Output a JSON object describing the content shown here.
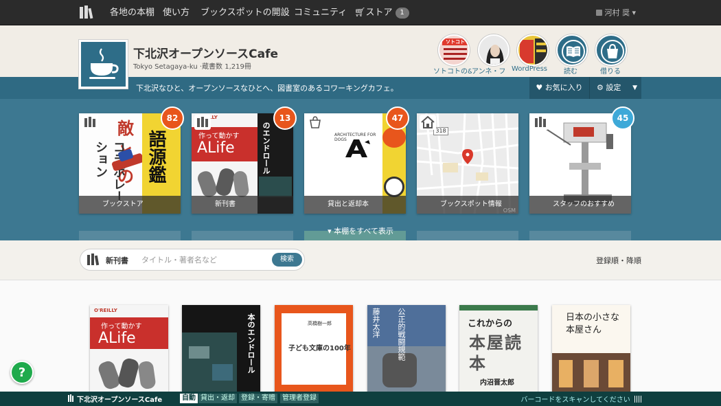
{
  "nav": {
    "items": [
      "各地の本棚",
      "使い方",
      "ブックスポットの開設",
      "コミュニティ"
    ],
    "store_label": "ストア",
    "store_count": "1",
    "user": "河村 奨"
  },
  "library": {
    "title": "下北沢オープンソースCafe",
    "subtitle": "Tokyo Setagaya-ku ·蔵書数 1,219冊",
    "tagline": "下北沢なひと、オープンソースなひとへ、図書室のあるコワーキングカフェ。",
    "fav_label": "お気に入り",
    "settings_label": "設定"
  },
  "chips": [
    {
      "label": "ソトコトの&",
      "cover": "ソトコト"
    },
    {
      "label": "アンネ・フ",
      "cover": ""
    },
    {
      "label": "WordPress",
      "cover": ""
    },
    {
      "label": "読む",
      "cover": ""
    },
    {
      "label": "借りる",
      "cover": ""
    }
  ],
  "shelves": [
    {
      "caption": "ブックストア",
      "count": "82",
      "color": "#e8561c"
    },
    {
      "caption": "新刊書",
      "count": "13",
      "color": "#e8561c"
    },
    {
      "caption": "貸出と返却本",
      "count": "47",
      "color": "#e8561c"
    },
    {
      "caption": "ブックスポット情報",
      "count": "",
      "color": "#e8561c"
    },
    {
      "caption": "スタッフのおすすめ",
      "count": "45",
      "color": "#3ea9d8"
    }
  ],
  "shelf_texts": {
    "c1_big": "敵との",
    "c1_big2": "コラボレーション",
    "c1_side": "語源鑑",
    "c2_brand": "O'REILLY",
    "c2_title": "作って動かす",
    "c2_big": "ALife",
    "c2_side": "のエンドロール",
    "c3_brand": "ARCHITECTURE FOR DOGS",
    "c4_road": "318",
    "c4_osm": "OSM"
  },
  "show_all": "▾ 本棚をすべて表示",
  "search": {
    "label": "新刊書",
    "placeholder": "タイトル・著者名など",
    "button": "検索",
    "sort": "登録順・降順"
  },
  "books": [
    {
      "texts": [
        "O'REILLY",
        "作って動かす",
        "ALife"
      ]
    },
    {
      "texts": [
        "本のエンドロール"
      ]
    },
    {
      "texts": [
        "高橋樹一郎",
        "子ども文庫の100年"
      ]
    },
    {
      "texts": [
        "公正的戦闘規範",
        "藤井太洋"
      ]
    },
    {
      "texts": [
        "これからの",
        "本屋読本",
        "内沼晋太郎"
      ]
    },
    {
      "texts": [
        "日本の小さな本屋さん"
      ]
    }
  ],
  "footer": {
    "title": "下北沢オープンソースCafe",
    "tabs": [
      "自動",
      "貸出・返却",
      "登録・寄贈",
      "管理者登録"
    ],
    "scan": "バーコードをスキャンしてください"
  },
  "help": "?",
  "colors": {
    "teal": "#3d7891",
    "teal_dark": "#24566b",
    "badge_orange": "#e8561c",
    "badge_blue": "#3ea9d8",
    "footer": "#0f3f3f",
    "help_green": "#1faa4c"
  }
}
